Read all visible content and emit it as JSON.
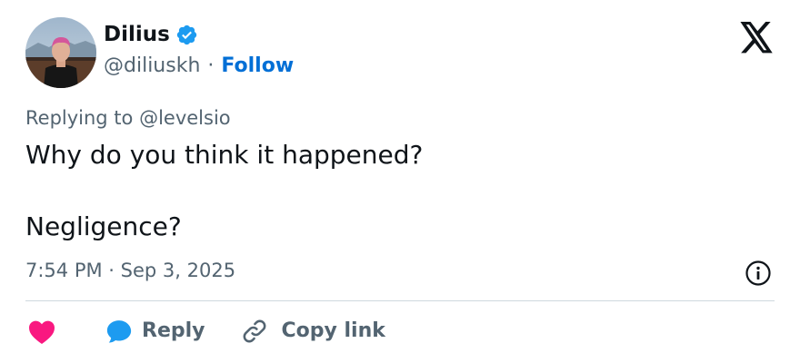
{
  "author": {
    "display_name": "Dilius",
    "handle": "@diliuskh",
    "separator": "·",
    "follow_label": "Follow",
    "verified_icon": "verified-badge-icon"
  },
  "brand": {
    "logo_icon": "x-logo-icon"
  },
  "tweet": {
    "replying_to": "Replying to @levelsio",
    "line1": "Why do you think it happened?",
    "line2": "Negligence?",
    "timestamp": "7:54 PM · Sep 3, 2025"
  },
  "actions": {
    "like_icon": "heart-icon",
    "reply_label": "Reply",
    "reply_icon": "speech-bubble-icon",
    "copy_label": "Copy link",
    "copy_icon": "link-icon",
    "info_icon": "info-icon"
  },
  "colors": {
    "link": "#006fd6",
    "text": "#0f1419",
    "muted": "#536471",
    "like": "#f91880",
    "reply": "#1d9bf0",
    "verified": "#1d9bf0",
    "divider": "#cfd9de"
  }
}
